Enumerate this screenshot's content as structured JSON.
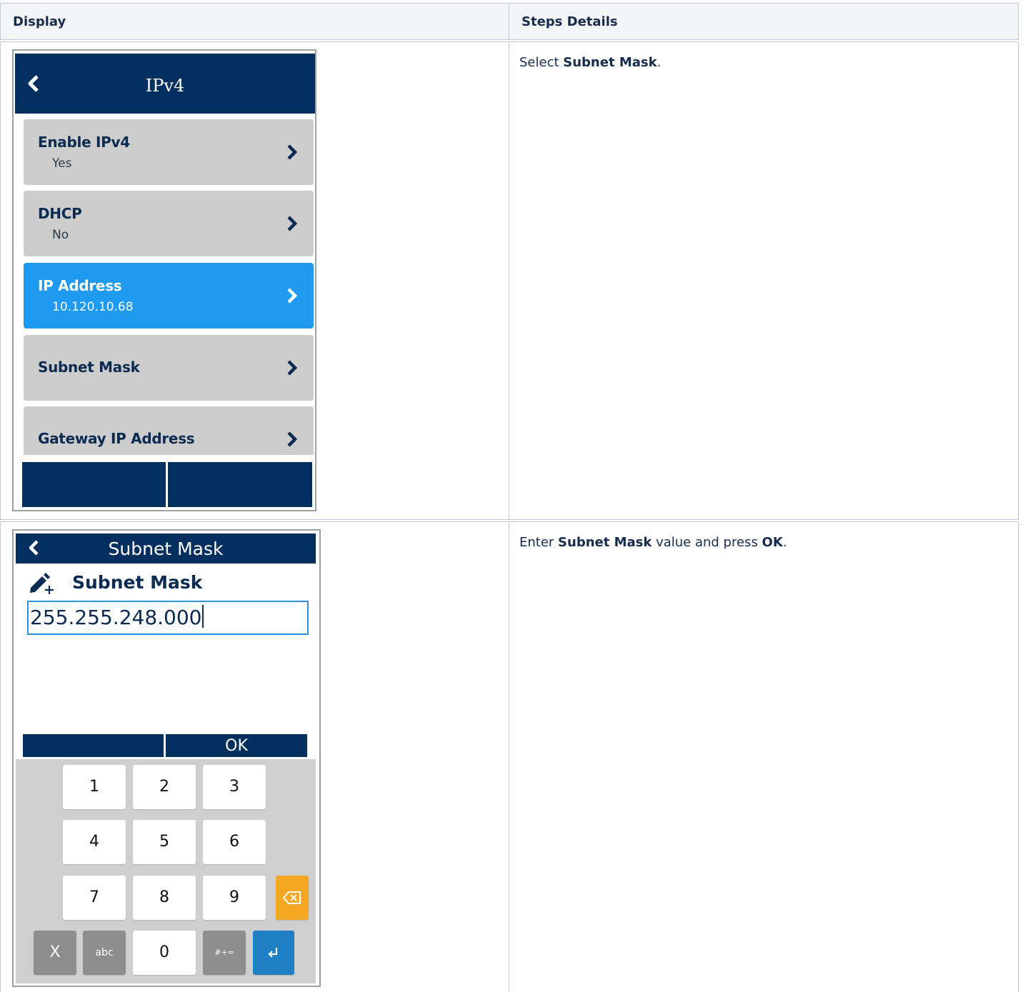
{
  "table": {
    "headers": {
      "display": "Display",
      "steps": "Steps Details"
    },
    "rows": [
      {
        "step_parts": [
          "Select ",
          "Subnet Mask",
          "."
        ],
        "screen": {
          "title": "IPv4",
          "items": [
            {
              "label": "Enable IPv4",
              "value": "Yes"
            },
            {
              "label": "DHCP",
              "value": "No"
            },
            {
              "label": "IP Address",
              "value": "10.120.10.68",
              "selected": "true"
            },
            {
              "label": "Subnet Mask"
            },
            {
              "label": "Gateway IP Address"
            }
          ]
        }
      },
      {
        "step_parts": [
          "Enter ",
          "Subnet Mask",
          " value and press ",
          "OK",
          "."
        ],
        "screen": {
          "title": "Subnet Mask",
          "field_label": "Subnet Mask",
          "field_value": "255.255.248.000",
          "softkey_left": "",
          "softkey_right": "OK",
          "keys": {
            "k1": "1",
            "k2": "2",
            "k3": "3",
            "k4": "4",
            "k5": "5",
            "k6": "6",
            "k7": "7",
            "k8": "8",
            "k9": "9",
            "kx": "X",
            "kabc": "abc",
            "k0": "0",
            "ksym": "#+="
          }
        }
      }
    ]
  },
  "colors": {
    "header_bg": "#f4f5f7",
    "device_title_bg": "#04305f",
    "selected_item": "#1e9bf0",
    "menu_item_bg": "#cdcdcd",
    "backspace_key": "#f5a623",
    "enter_key": "#1f7fc4"
  },
  "icons": [
    "back-chevron-icon",
    "chevron-right-icon",
    "edit-pencil-plus-icon",
    "backspace-icon",
    "enter-return-icon"
  ]
}
